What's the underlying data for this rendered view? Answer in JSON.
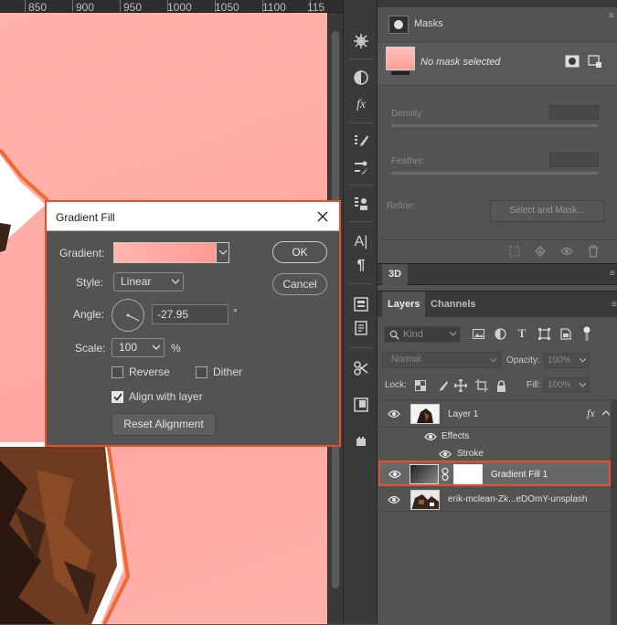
{
  "ruler": {
    "labels": [
      "850",
      "900",
      "950",
      "1000",
      "1050",
      "1100",
      "115"
    ]
  },
  "dialog": {
    "title": "Gradient Fill",
    "gradient_label": "Gradient:",
    "style_label": "Style:",
    "style_value": "Linear",
    "angle_label": "Angle:",
    "angle_value": "-27.95",
    "angle_unit": "°",
    "scale_label": "Scale:",
    "scale_value": "100",
    "scale_unit": "%",
    "reverse_label": "Reverse",
    "reverse_checked": false,
    "dither_label": "Dither",
    "dither_checked": false,
    "align_label": "Align with layer",
    "align_checked": true,
    "reset_label": "Reset Alignment",
    "ok_label": "OK",
    "cancel_label": "Cancel",
    "gradient_colors": [
      "#ffb6b0",
      "#ff9a93"
    ]
  },
  "properties": {
    "title": "Masks",
    "no_mask": "No mask selected",
    "density_label": "Density:",
    "feather_label": "Feather:",
    "refine_label": "Refine:",
    "select_and_mask": "Select and Mask..."
  },
  "panels": {
    "tab_3d": "3D",
    "layers_tab": "Layers",
    "channels_tab": "Channels",
    "kind_label": "Kind",
    "blend_mode": "Normal",
    "opacity_label": "Opacity:",
    "opacity_value": "100%",
    "lock_label": "Lock:",
    "fill_label": "Fill:",
    "fill_value": "100%"
  },
  "layers": {
    "layer1": "Layer 1",
    "fx": "fx",
    "effects": "Effects",
    "stroke": "Stroke",
    "gradient_fill": "Gradient Fill 1",
    "photo": "erik-mclean-Zk...eDOmY-unsplash"
  },
  "colors": {
    "accent": "#e8502b",
    "canvas": "#ffa8a2",
    "panel": "#535353"
  }
}
